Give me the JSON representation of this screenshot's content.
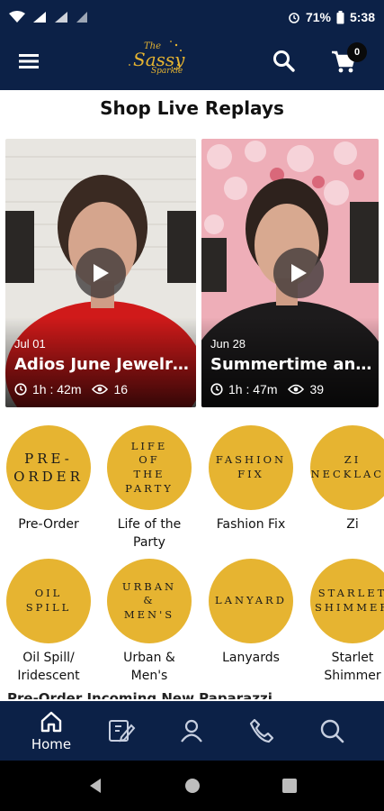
{
  "status_bar": {
    "battery": "71%",
    "time": "5:38"
  },
  "header": {
    "logo_line1": "The",
    "logo_line2": "Sassy",
    "logo_line3": "Sparkle",
    "cart_count": "0"
  },
  "page": {
    "title": "Shop Live Replays"
  },
  "videos": [
    {
      "date": "Jul 01",
      "title": "Adios June Jewelry...",
      "duration": "1h : 42m",
      "views": "16"
    },
    {
      "date": "Jun 28",
      "title": "Summertime and t...",
      "duration": "1h : 47m",
      "views": "39"
    }
  ],
  "categories": [
    {
      "circle_text": "PRE-\nORDER",
      "label": "Pre-Order"
    },
    {
      "circle_text": "LIFE\nOF\nTHE\nPARTY",
      "label": "Life of the\nParty"
    },
    {
      "circle_text": "FASHION\nFIX",
      "label": "Fashion Fix"
    },
    {
      "circle_text": "ZI\nNECKLACE",
      "label": "Zi"
    },
    {
      "circle_text": "OIL\nSPILL",
      "label": "Oil Spill/\nIridescent"
    },
    {
      "circle_text": "URBAN\n&\nMEN'S",
      "label": "Urban &\nMen's"
    },
    {
      "circle_text": "LANYARD",
      "label": "Lanyards"
    },
    {
      "circle_text": "STARLET\nSHIMMER",
      "label": "Starlet\nShimmer"
    }
  ],
  "next_section_peek": "Pre-Order Incoming New Paparazzi...",
  "bottom_nav": {
    "home_label": "Home",
    "items": [
      "home-icon",
      "catalog-icon",
      "account-icon",
      "phone-icon",
      "search-icon"
    ]
  },
  "colors": {
    "brand_navy": "#0c2147",
    "brand_gold": "#e6b431"
  }
}
